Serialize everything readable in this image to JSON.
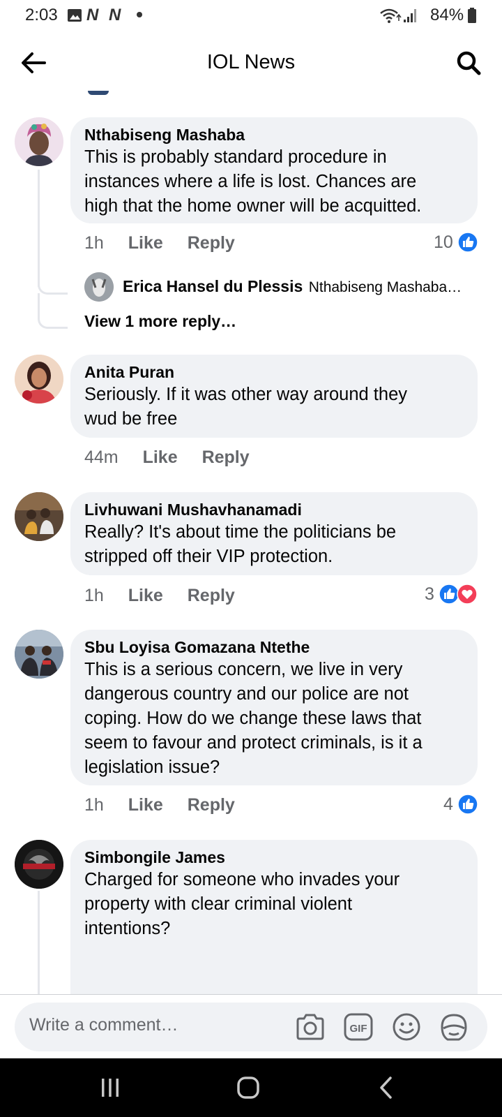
{
  "status_bar": {
    "time": "2:03",
    "battery": "84%",
    "icons": [
      "image-icon",
      "n-icon",
      "n-icon",
      "dot-icon",
      "wifi-icon",
      "signal-icon",
      "battery-icon"
    ]
  },
  "header": {
    "title": "IOL News",
    "back_icon": "back-arrow-icon",
    "search_icon": "search-icon"
  },
  "comments": [
    {
      "name": "Nthabiseng Mashaba",
      "text": "This is probably standard procedure in\ninstances where a life is lost. Chances are\nhigh that the home owner will be acquitted.",
      "time": "1h",
      "like": "Like",
      "reply": "Reply",
      "reaction_count": "10",
      "reactions": [
        "like"
      ]
    },
    {
      "name": "Anita Puran",
      "text": "Seriously. If it was other way around they\nwud be free",
      "time": "44m",
      "like": "Like",
      "reply": "Reply"
    },
    {
      "name": "Livhuwani Mushavhanamadi",
      "text": "Really? It's about time the politicians be\nstripped off their VIP protection.",
      "time": "1h",
      "like": "Like",
      "reply": "Reply",
      "reaction_count": "3",
      "reactions": [
        "like",
        "love"
      ]
    },
    {
      "name": "Sbu Loyisa Gomazana Ntethe",
      "text": "This is a serious concern, we live in very\ndangerous country and our police are not\ncoping. How do we change these laws that\nseem to favour and protect criminals, is it a\nlegislation issue?",
      "time": "1h",
      "like": "Like",
      "reply": "Reply",
      "reaction_count": "4",
      "reactions": [
        "like"
      ]
    },
    {
      "name": "Simbongile James",
      "text": "Charged for someone who invades your\nproperty with clear criminal violent\nintentions?"
    }
  ],
  "reply_preview": {
    "name": "Erica Hansel du Plessis",
    "snippet": "Nthabiseng Mashaba…",
    "view_more": "View 1 more reply…"
  },
  "comment_box": {
    "placeholder": "Write a comment…",
    "icons": [
      "camera-icon",
      "gif-icon",
      "emoji-icon",
      "sticker-icon"
    ]
  },
  "nav_bar": {
    "icons": [
      "recent-apps-icon",
      "home-icon",
      "back-icon"
    ]
  },
  "colors": {
    "bubble": "#f0f2f5",
    "meta_text": "#65676b",
    "like_blue": "#1877f2",
    "love_red": "#f33e58"
  }
}
